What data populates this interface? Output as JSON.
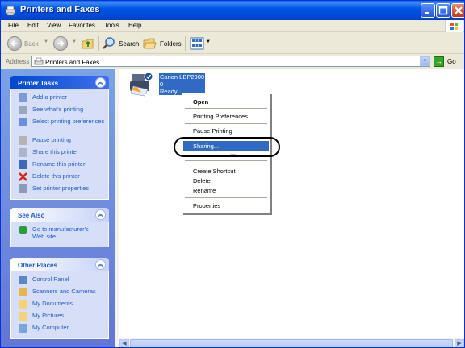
{
  "window": {
    "title": "Printers and Faxes"
  },
  "menubar": {
    "items": [
      "File",
      "Edit",
      "View",
      "Favorites",
      "Tools",
      "Help"
    ]
  },
  "toolbar": {
    "back_label": "Back",
    "search_label": "Search",
    "folders_label": "Folders"
  },
  "address": {
    "label": "Address",
    "value": "Printers and Faxes",
    "go_label": "Go"
  },
  "taskpane": {
    "printer_tasks": {
      "title": "Printer Tasks",
      "links": [
        "Add a printer",
        "See what's printing",
        "Select printing preferences",
        "Pause printing",
        "Share this printer",
        "Rename this printer",
        "Delete this printer",
        "Set printer properties"
      ]
    },
    "see_also": {
      "title": "See Also",
      "links": [
        "Go to manufacturer's Web site"
      ]
    },
    "other_places": {
      "title": "Other Places",
      "links": [
        "Control Panel",
        "Scanners and Cameras",
        "My Documents",
        "My Pictures",
        "My Computer"
      ]
    }
  },
  "printer": {
    "name": "Canon LBP2900",
    "count": "0",
    "status": "Ready"
  },
  "context_menu": {
    "items": [
      "Open",
      "Printing Preferences...",
      "Pause Printing",
      "Sharing...",
      "Use Printer Offline",
      "Create Shortcut",
      "Delete",
      "Rename",
      "Properties"
    ]
  }
}
